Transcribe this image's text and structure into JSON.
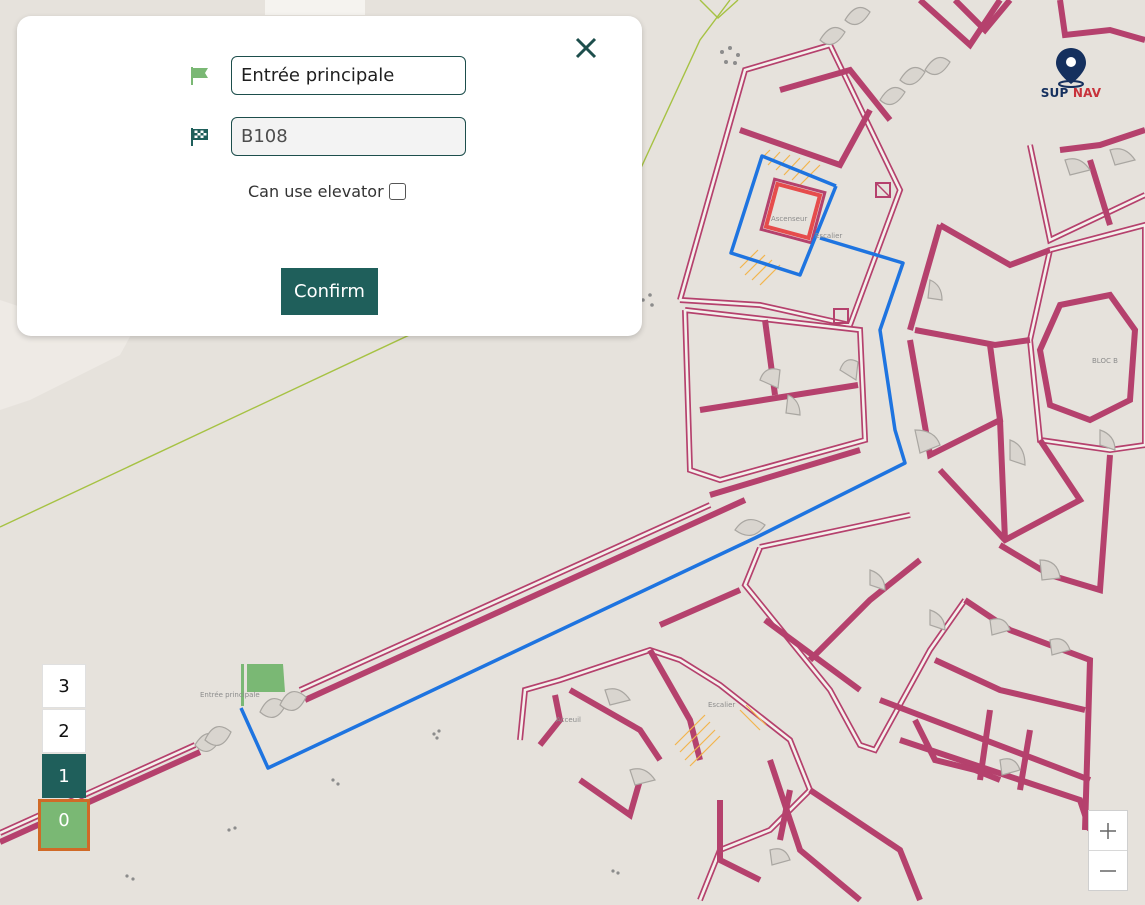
{
  "panel": {
    "start_value": "Entrée principale",
    "destination_value": "B108",
    "elevator_label": "Can use elevator",
    "elevator_checked": false,
    "confirm_label": "Confirm",
    "close_icon": "close-icon",
    "start_icon": "flag-icon",
    "destination_icon": "checkered-flag-icon"
  },
  "logo": {
    "word1": "SUP",
    "word2": "NAV",
    "colors": {
      "sup": "#15305e",
      "nav": "#c8323b"
    }
  },
  "map_labels": {
    "entrance": "Entrée principale",
    "elevator": "Ascenseur",
    "stairs_top": "Escalier",
    "stairs_bottom": "Escalier",
    "welcome": "Acceuil",
    "block": "BLOC B"
  },
  "floors": [
    "3",
    "2",
    "1",
    "0"
  ],
  "active_floor": "0",
  "selected_floor": "1",
  "zoom": {
    "in": "+",
    "out": "—"
  },
  "colors": {
    "route": "#1e74e0",
    "walls": "#b5416d",
    "primary": "#1f5f5b",
    "start_flag": "#7ab874",
    "elevator_highlight": "#e64c4c"
  }
}
